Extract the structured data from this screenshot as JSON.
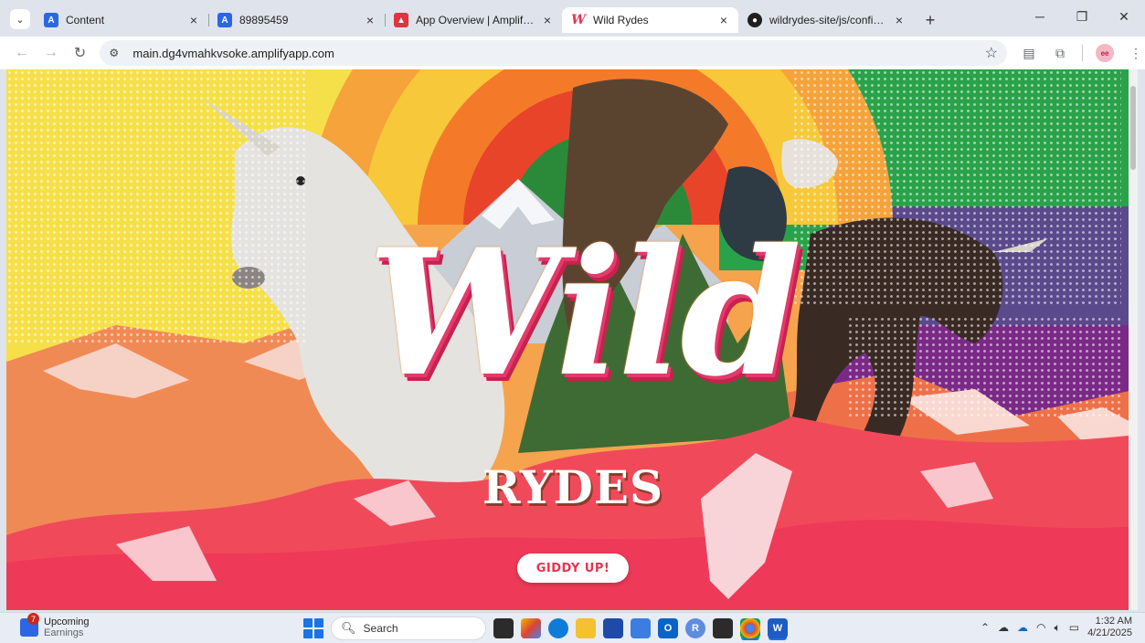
{
  "browser": {
    "tabs": [
      {
        "title": "Content",
        "favicon": "amplify-icon",
        "active": false
      },
      {
        "title": "89895459",
        "favicon": "amplify-icon",
        "active": false
      },
      {
        "title": "App Overview | Amplify | us-eas",
        "favicon": "aws-icon",
        "active": false
      },
      {
        "title": "Wild Rydes",
        "favicon": "wild-rydes-icon",
        "active": true
      },
      {
        "title": "wildrydes-site/js/config.js at ma",
        "favicon": "github-icon",
        "active": false
      }
    ],
    "new_tab_symbol": "+",
    "url": "main.dg4vmahkvsoke.amplifyapp.com",
    "avatar_initials": "ee"
  },
  "page": {
    "title": "Wild",
    "subtitle": "RYDES",
    "cta_label": "GIDDY UP!",
    "colors": {
      "accent": "#e8334f",
      "sun_red": "#e8442a",
      "sky_yellow": "#f6e04a",
      "sky_green": "#2aa24a",
      "mountain": "#f07a4a"
    }
  },
  "taskbar": {
    "news_title": "Upcoming",
    "news_sub": "Earnings",
    "news_badge": "7",
    "search_placeholder": "Search",
    "time": "1:32 AM",
    "date": "4/21/2025"
  }
}
